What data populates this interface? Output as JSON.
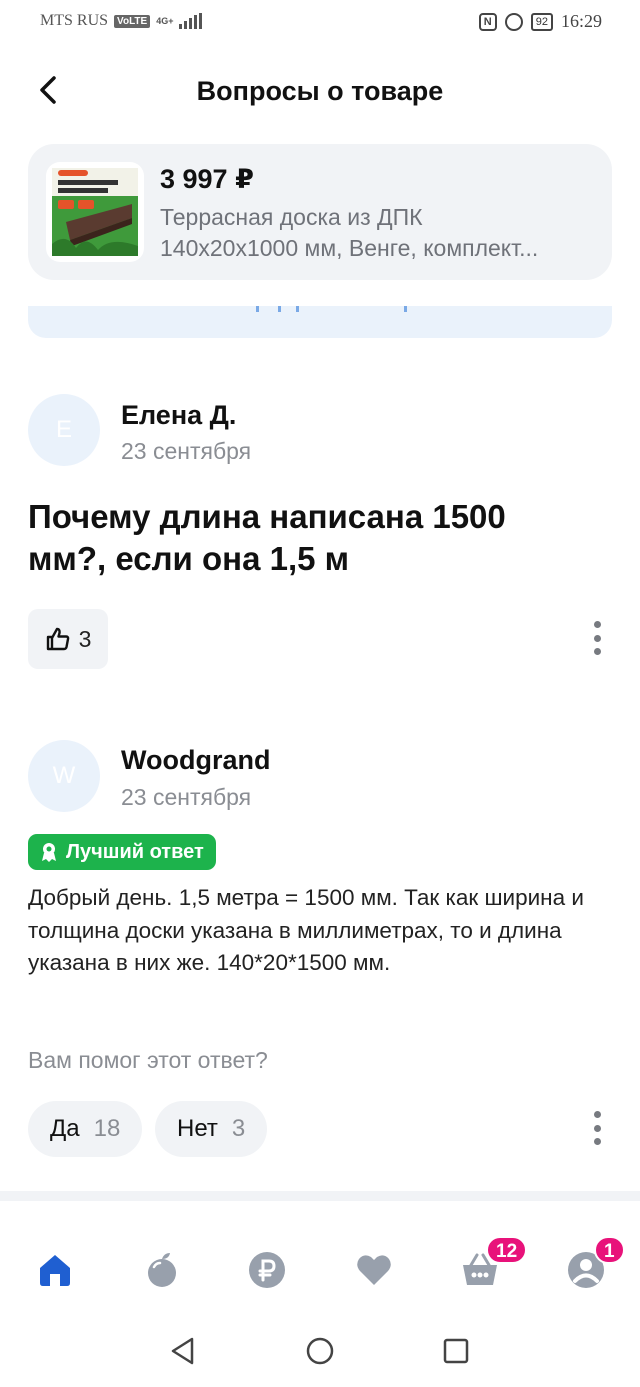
{
  "status_bar": {
    "carrier": "MTS RUS",
    "volte": "VoLTE",
    "network": "4G+",
    "nfc": "N",
    "battery": "92",
    "time": "16:29"
  },
  "header": {
    "title": "Вопросы о товаре"
  },
  "product": {
    "price": "3 997 ₽",
    "name_line1": "Террасная доска из ДПК",
    "name_line2": "140х20х1000 мм, Венге, комплект..."
  },
  "question": {
    "avatar_initial": "Е",
    "author": "Елена Д.",
    "date": "23 сентября",
    "text": "Почему длина написана 1500 мм?, если она 1,5 м",
    "likes": "3"
  },
  "answer": {
    "avatar_initial": "W",
    "author": "Woodgrand",
    "date": "23 сентября",
    "best_label": "Лучший ответ",
    "text": "Добрый день. 1,5 метра = 1500 мм. Так как ширина и толщина доски указана в миллиметрах, то и длина указана в них же. 140*20*1500 мм.",
    "helpful_question": "Вам помог этот ответ?",
    "yes_label": "Да",
    "yes_count": "18",
    "no_label": "Нет",
    "no_count": "3"
  },
  "tab_bar": {
    "items": [
      {
        "icon": "home-icon",
        "active": true
      },
      {
        "icon": "fruit-icon"
      },
      {
        "icon": "ruble-icon"
      },
      {
        "icon": "heart-icon"
      },
      {
        "icon": "basket-icon",
        "badge": "12"
      },
      {
        "icon": "profile-icon",
        "badge": "1"
      }
    ]
  },
  "colors": {
    "accent": "#1f5fd1",
    "tab_icon": "#98a0ac",
    "badge": "#e8127a",
    "best_answer": "#1db34c",
    "card_bg": "#f1f3f6"
  }
}
